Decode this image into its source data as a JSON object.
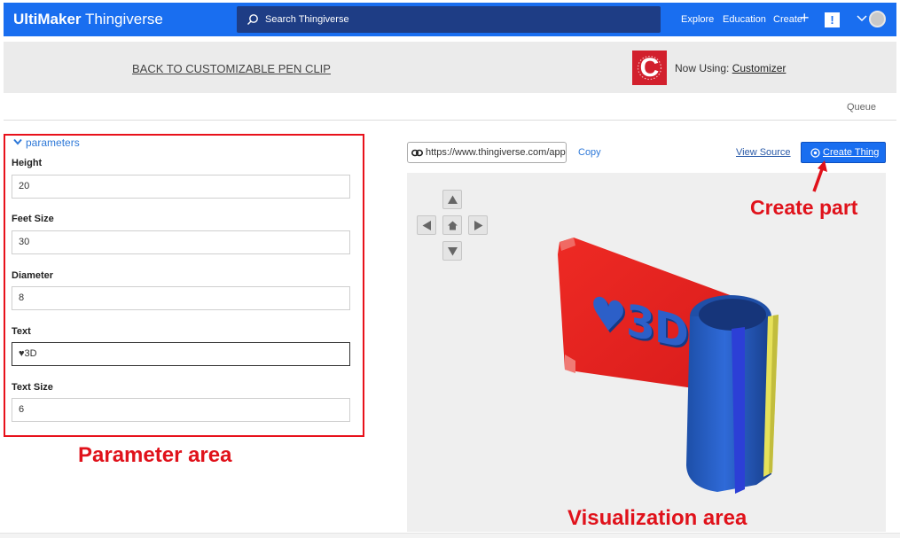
{
  "header": {
    "brand_bold": "UltiMaker",
    "brand_light": "Thingiverse",
    "search_placeholder": "Search Thingiverse",
    "nav": {
      "explore": "Explore",
      "education": "Education",
      "create": "Create"
    },
    "plus_symbol": "+",
    "notification_symbol": "!",
    "brand_color": "#196ef0"
  },
  "customizer_bar": {
    "back_link": "BACK TO CUSTOMIZABLE PEN CLIP",
    "logo_letter": "C",
    "now_using_prefix": "Now Using:",
    "now_using_app": "Customizer",
    "queue": "Queue"
  },
  "parameters": {
    "section_label": "parameters",
    "fields": [
      {
        "label": "Height",
        "value": "20"
      },
      {
        "label": "Feet Size",
        "value": "30"
      },
      {
        "label": "Diameter",
        "value": "8"
      },
      {
        "label": "Text",
        "value": "♥3D"
      },
      {
        "label": "Text Size",
        "value": "6"
      }
    ]
  },
  "toolbar": {
    "url": "https://www.thingiverse.com/app",
    "copy": "Copy",
    "view_source": "View Source",
    "create_thing": "Create Thing"
  },
  "model": {
    "text": "♥3D",
    "plate_color": "#e8201f",
    "tube_color": "#2a5fcc",
    "edge_color": "#e6e15a"
  },
  "annotations": {
    "parameter_area": "Parameter area",
    "visualization_area": "Visualization area",
    "create_part": "Create part",
    "color": "#e0121b"
  }
}
